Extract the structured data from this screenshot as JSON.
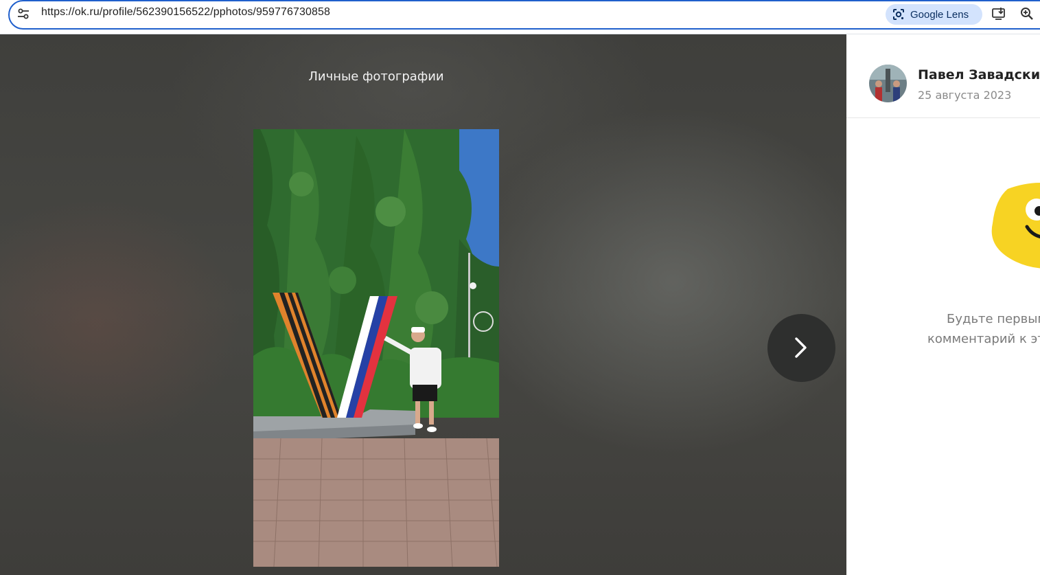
{
  "browser": {
    "url": "https://ok.ru/profile/562390156522/pphotos/959776730858",
    "lens_label": "Google Lens",
    "icons": {
      "site_info": "tune-icon",
      "lens": "camera-lens-icon",
      "install": "install-app-icon",
      "zoom": "zoom-icon"
    }
  },
  "viewer": {
    "album_title": "Личные фотографии",
    "next_icon": "chevron-right-icon"
  },
  "side_panel": {
    "author_name": "Павел Завадский",
    "post_date": "25 августа 2023",
    "empty_comments_line1": "Будьте первым",
    "empty_comments_line2": "комментарий к эт"
  },
  "colors": {
    "omnibox_border": "#1f5fcc",
    "lens_bg": "#d3e3fd",
    "viewer_bg": "#444441",
    "mascot_yellow": "#f7d323"
  }
}
